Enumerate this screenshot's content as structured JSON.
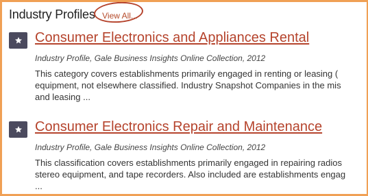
{
  "header": {
    "title": "Industry Profiles",
    "view_all": "View All..."
  },
  "results": [
    {
      "title": "Consumer Electronics and Appliances Rental",
      "meta": "Industry Profile, Gale Business Insights Online Collection, 2012",
      "description_lines": [
        "This category covers establishments primarily engaged in renting or leasing (",
        "equipment, not elsewhere classified. Industry Snapshot Companies in the mis",
        "and leasing ..."
      ],
      "icon": "star-icon"
    },
    {
      "title": "Consumer Electronics Repair and Maintenance",
      "meta": "Industry Profile, Gale Business Insights Online Collection, 2012",
      "description_lines": [
        "This classification covers establishments primarily engaged in repairing radios",
        "stereo equipment, and tape recorders. Also included are establishments engag",
        "..."
      ],
      "icon": "star-icon"
    }
  ],
  "colors": {
    "border": "#f0a055",
    "link": "#b5432c",
    "icon_bg": "#4b4a5e"
  }
}
